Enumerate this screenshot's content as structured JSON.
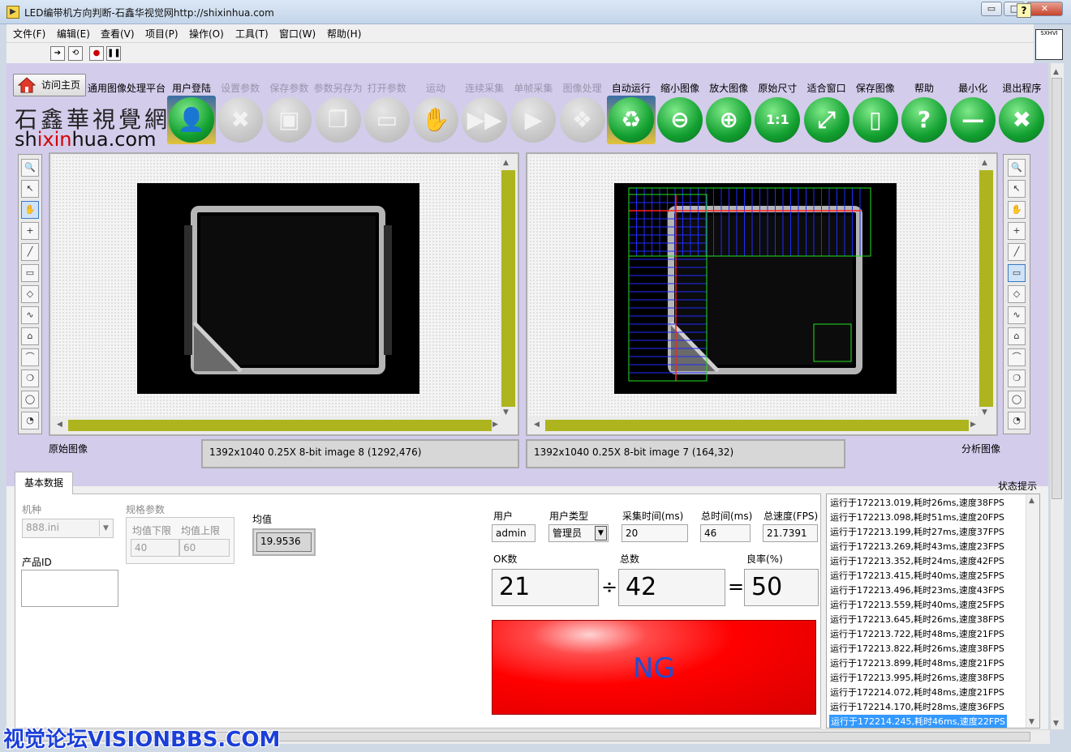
{
  "window": {
    "title": "LED编带机方向判断-石鑫华视觉网http://shixinhua.com",
    "minimize": "▭",
    "restore": "□",
    "close": "✕"
  },
  "menu": [
    "文件(F)",
    "编辑(E)",
    "查看(V)",
    "项目(P)",
    "操作(O)",
    "工具(T)",
    "窗口(W)",
    "帮助(H)"
  ],
  "header": {
    "home_label": "访问主页",
    "platform_label": "通用图像处理平台",
    "brand_cn": "石鑫華視覺網",
    "brand_en_prefix": "sh",
    "brand_en_red": "ixin",
    "brand_en_suffix": "hua.com",
    "right_logo": "SXHVI"
  },
  "tools": [
    {
      "label": "用户登陆",
      "icon": "user-icon",
      "glyph": "👤",
      "style": "green",
      "enabled": true
    },
    {
      "label": "设置参数",
      "icon": "tools-icon",
      "glyph": "✖",
      "style": "dim",
      "enabled": false
    },
    {
      "label": "保存参数",
      "icon": "save-icon",
      "glyph": "▣",
      "style": "dim",
      "enabled": false
    },
    {
      "label": "参数另存为",
      "icon": "save-as-icon",
      "glyph": "❐",
      "style": "dim",
      "enabled": false
    },
    {
      "label": "打开参数",
      "icon": "folder-icon",
      "glyph": "▭",
      "style": "dim",
      "enabled": false
    },
    {
      "label": "运动",
      "icon": "hand-icon",
      "glyph": "✋",
      "style": "dim",
      "enabled": false
    },
    {
      "label": "连续采集",
      "icon": "fast-forward-icon",
      "glyph": "▶▶",
      "style": "dim",
      "enabled": false
    },
    {
      "label": "单帧采集",
      "icon": "play-icon",
      "glyph": "▶",
      "style": "dim",
      "enabled": false
    },
    {
      "label": "图像处理",
      "icon": "windows-icon",
      "glyph": "❖",
      "style": "dim",
      "enabled": false
    },
    {
      "label": "自动运行",
      "icon": "recycle-icon",
      "glyph": "♻",
      "style": "green",
      "enabled": true
    },
    {
      "label": "缩小图像",
      "icon": "zoom-out-icon",
      "glyph": "⊖",
      "style": "green",
      "enabled": true
    },
    {
      "label": "放大图像",
      "icon": "zoom-in-icon",
      "glyph": "⊕",
      "style": "green",
      "enabled": true
    },
    {
      "label": "原始尺寸",
      "icon": "zoom-1to1-icon",
      "glyph": "1:1",
      "style": "green",
      "enabled": true
    },
    {
      "label": "适合窗口",
      "icon": "zoom-fit-icon",
      "glyph": "⤢",
      "style": "green",
      "enabled": true
    },
    {
      "label": "保存图像",
      "icon": "document-icon",
      "glyph": "▯",
      "style": "green",
      "enabled": true
    },
    {
      "label": "帮助",
      "icon": "help-icon",
      "glyph": "?",
      "style": "green",
      "enabled": true
    },
    {
      "label": "最小化",
      "icon": "minus-icon",
      "glyph": "—",
      "style": "green",
      "enabled": true
    },
    {
      "label": "退出程序",
      "icon": "exit-icon",
      "glyph": "✖",
      "style": "green",
      "enabled": true
    }
  ],
  "viewers": {
    "left_caption": "原始图像",
    "right_caption": "分析图像",
    "left_info": "1392x1040 0.25X 8-bit image 8     (1292,476)",
    "right_info": "1392x1040 0.25X 8-bit image 7     (164,32)"
  },
  "tabs": {
    "basic": "基本数据"
  },
  "basic": {
    "model_label": "机种",
    "model_value": "888.ini",
    "spec_label": "规格参数",
    "mean_lower_label": "均值下限",
    "mean_upper_label": "均值上限",
    "mean_lower": "40",
    "mean_upper": "60",
    "mean_label": "均值",
    "mean_value": "19.9536",
    "product_id_label": "产品ID",
    "product_id": ""
  },
  "stats": {
    "user_label": "用户",
    "user": "admin",
    "user_type_label": "用户类型",
    "user_type": "管理员",
    "acq_time_label": "采集时间(ms)",
    "acq_time": "20",
    "total_time_label": "总时间(ms)",
    "total_time": "46",
    "total_speed_label": "总速度(FPS)",
    "total_speed": "21.7391",
    "ok_label": "OK数",
    "ok_count": "21",
    "total_label": "总数",
    "total_count": "42",
    "yield_label": "良率(%)",
    "yield": "50",
    "divide": "÷",
    "equals": "=",
    "result": "NG"
  },
  "status": {
    "label": "状态提示",
    "log": [
      "运行于172213.019,耗时26ms,速度38FPS",
      "运行于172213.098,耗时51ms,速度20FPS",
      "运行于172213.199,耗时27ms,速度37FPS",
      "运行于172213.269,耗时43ms,速度23FPS",
      "运行于172213.352,耗时24ms,速度42FPS",
      "运行于172213.415,耗时40ms,速度25FPS",
      "运行于172213.496,耗时23ms,速度43FPS",
      "运行于172213.559,耗时40ms,速度25FPS",
      "运行于172213.645,耗时26ms,速度38FPS",
      "运行于172213.722,耗时48ms,速度21FPS",
      "运行于172213.822,耗时26ms,速度38FPS",
      "运行于172213.899,耗时48ms,速度21FPS",
      "运行于172213.995,耗时26ms,速度38FPS",
      "运行于172214.072,耗时48ms,速度21FPS",
      "运行于172214.170,耗时28ms,速度36FPS",
      "运行于172214.245,耗时46ms,速度22FPS"
    ]
  },
  "watermark": "视觉论坛VISIONBBS.COM"
}
